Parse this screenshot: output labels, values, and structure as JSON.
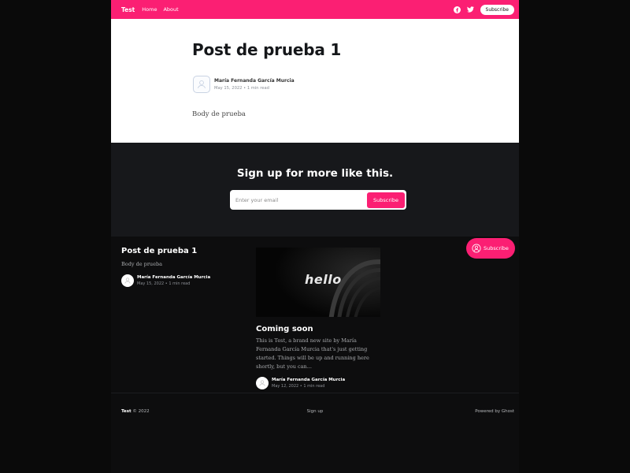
{
  "nav": {
    "brand": "Test",
    "links": [
      "Home",
      "About"
    ],
    "subscribe_label": "Subscribe",
    "icons": [
      "facebook-icon",
      "twitter-icon"
    ],
    "accent_color": "#fb1f73"
  },
  "article": {
    "title": "Post de prueba 1",
    "author": "María Fernanda García Murcia",
    "date": "May 15, 2022",
    "read_time": "1 min read",
    "body": "Body de prueba"
  },
  "signup": {
    "heading": "Sign up for more like this.",
    "email_placeholder": "Enter your email",
    "button_label": "Subscribe"
  },
  "floating_subscribe": {
    "label": "Subscribe",
    "icon": "user-circle-icon"
  },
  "posts": [
    {
      "title": "Post de prueba 1",
      "excerpt": "Body de prueba",
      "author": "María Fernanda García Murcia",
      "date": "May 15, 2022",
      "read_time": "1 min read"
    },
    {
      "image_text": "hello",
      "title": "Coming soon",
      "excerpt": "This is Test, a brand new site by María Fernanda García Murcia that's just getting started. Things will be up and running here shortly, but you can...",
      "author": "María Fernanda García Murcia",
      "date": "May 12, 2022",
      "read_time": "1 min read"
    }
  ],
  "footer": {
    "brand": "Test",
    "copyright": "© 2022",
    "signup_link": "Sign up",
    "powered_by": "Powered by Ghost"
  }
}
